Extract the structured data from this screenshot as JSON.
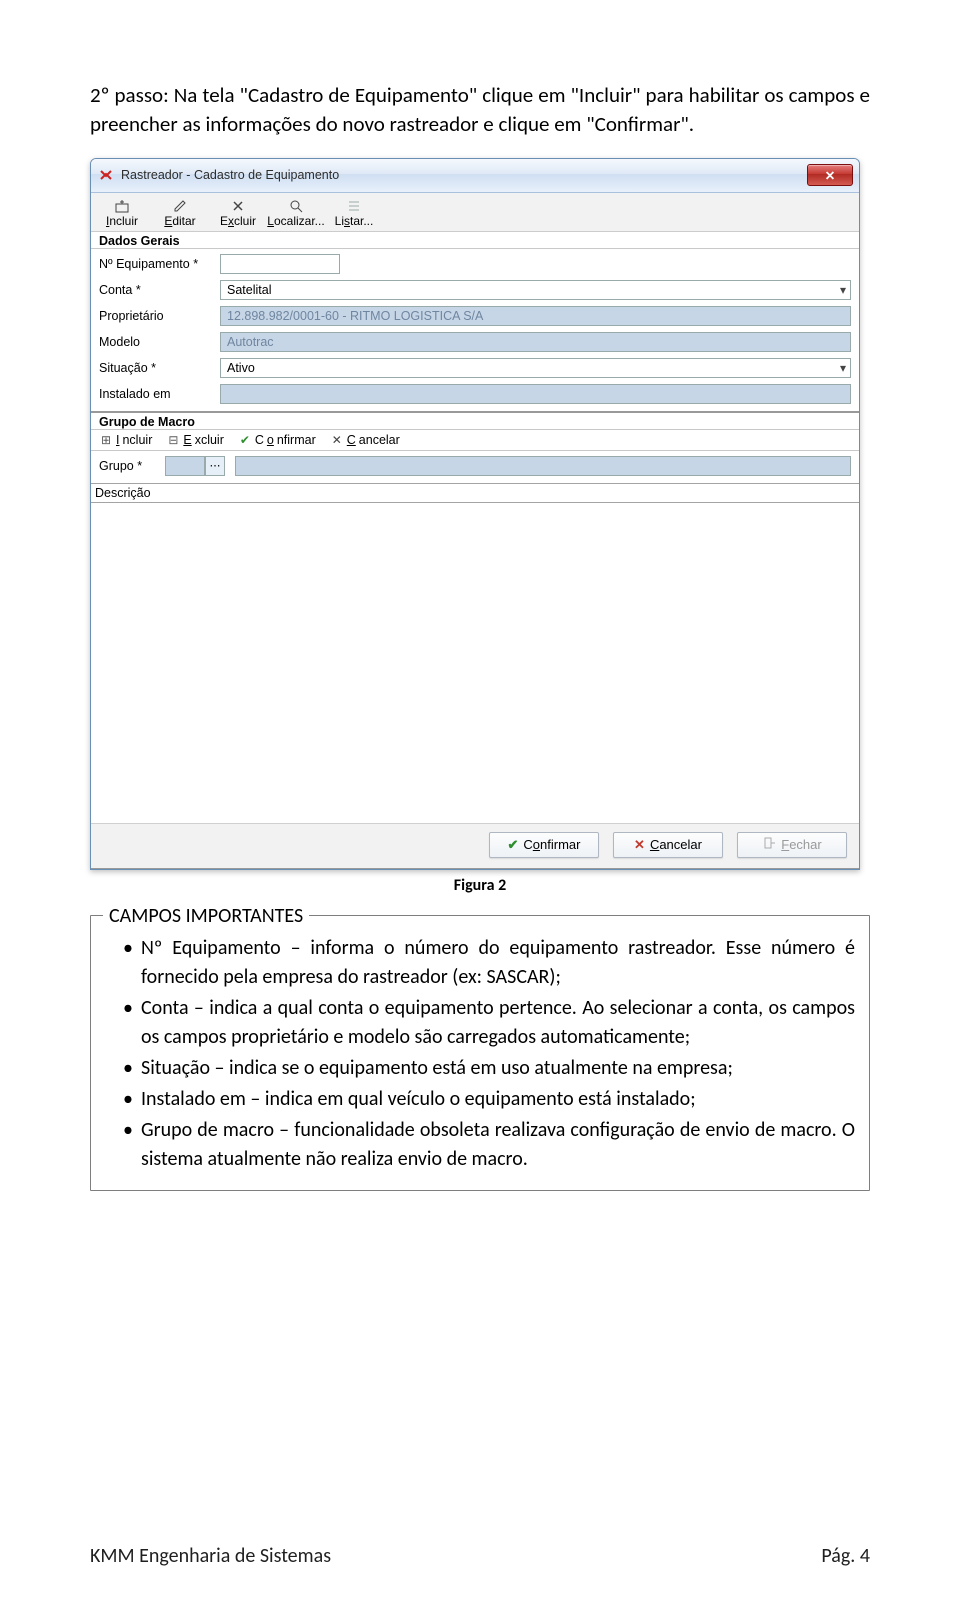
{
  "doc": {
    "intro": "2º passo: Na tela \"Cadastro de Equipamento\" clique em \"Incluir\" para habilitar os campos e preencher as informações do novo rastreador e clique em \"Confirmar\".",
    "caption": "Figura 2",
    "callout_title": "CAMPOS IMPORTANTES",
    "bullets": [
      "Nº Equipamento – informa o número do equipamento rastreador. Esse número é fornecido pela empresa do rastreador (ex: SASCAR);",
      "Conta – indica a qual conta o equipamento pertence. Ao selecionar a conta, os campos os campos proprietário e modelo são carregados automaticamente;",
      "Situação – indica se o equipamento está em uso atualmente na empresa;",
      "Instalado em – indica em qual veículo o equipamento está instalado;",
      "Grupo de macro – funcionalidade obsoleta realizava configuração de envio de macro. O sistema atualmente não realiza envio de macro."
    ],
    "footer_left": "KMM Engenharia de Sistemas",
    "footer_right": "Pág. 4"
  },
  "app": {
    "title": "Rastreador - Cadastro de Equipamento",
    "toolbar": {
      "incluir": "Incluir",
      "editar": "Editar",
      "excluir": "Excluir",
      "localizar": "Localizar...",
      "listar": "Listar..."
    },
    "sections": {
      "dados": "Dados Gerais",
      "macro": "Grupo de Macro",
      "descricao": "Descrição"
    },
    "fields": {
      "num_label": "Nº Equipamento *",
      "conta_label": "Conta *",
      "conta_value": "Satelital",
      "prop_label": "Proprietário",
      "prop_value": "12.898.982/0001-60 - RITMO LOGISTICA S/A",
      "modelo_label": "Modelo",
      "modelo_value": "Autotrac",
      "situacao_label": "Situação *",
      "situacao_value": "Ativo",
      "instalado_label": "Instalado em",
      "grupo_label": "Grupo *"
    },
    "sub_toolbar": {
      "incluir": "Incluir",
      "excluir": "Excluir",
      "confirmar": "Confirmar",
      "cancelar": "Cancelar"
    },
    "footer": {
      "confirmar": "Confirmar",
      "cancelar": "Cancelar",
      "fechar": "Fechar"
    }
  }
}
